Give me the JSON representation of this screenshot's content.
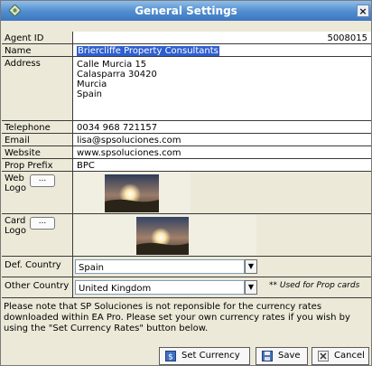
{
  "window": {
    "title": "General Settings",
    "close_label": "×"
  },
  "fields": {
    "agent_id": {
      "label": "Agent ID",
      "value": "5008015"
    },
    "name": {
      "label": "Name",
      "value": "Briercliffe Property Consultants"
    },
    "address": {
      "label": "Address",
      "lines": [
        "Calle Murcia 15",
        "Calasparra 30420",
        "Murcia",
        "Spain"
      ]
    },
    "telephone": {
      "label": "Telephone",
      "value": "0034 968 721157"
    },
    "email": {
      "label": "Email",
      "value": "lisa@spsoluciones.com"
    },
    "website": {
      "label": "Website",
      "value": "www.spsoluciones.com"
    },
    "prop_prefix": {
      "label": "Prop Prefix",
      "value": "BPC"
    },
    "web_logo": {
      "label_line1": "Web",
      "label_line2": "Logo",
      "button": "..."
    },
    "card_logo": {
      "label_line1": "Card",
      "label_line2": "Logo",
      "button": "..."
    },
    "def_country": {
      "label": "Def. Country",
      "value": "Spain"
    },
    "other_country": {
      "label": "Other Country",
      "value": "United Kingdom",
      "note": "** Used for Prop cards"
    }
  },
  "notice": "Please note that SP Soluciones is not reponsible for the currency rates downloaded within EA Pro. Please set your own currency rates if you wish by using the \"Set Currency Rates\" button below.",
  "buttons": {
    "set_rates": "Set Currency Rates",
    "save": "Save",
    "cancel": "Cancel"
  },
  "colors": {
    "titlebar": "#4f8ccf",
    "selection": "#2f5fcf",
    "dialog_bg": "#ece9d8"
  }
}
